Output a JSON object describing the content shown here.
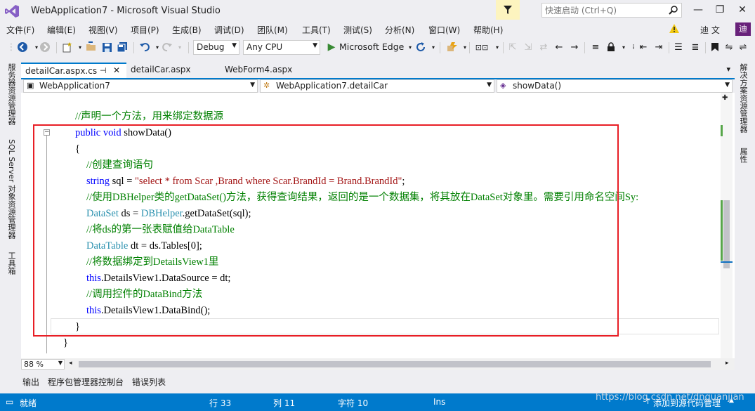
{
  "window": {
    "title": "WebApplication7 - Microsoft Visual Studio",
    "quick_launch_placeholder": "快速启动 (Ctrl+Q)",
    "minimize": "—",
    "restore": "❐",
    "close": "✕"
  },
  "menu": {
    "items": [
      "文件(F)",
      "编辑(E)",
      "视图(V)",
      "项目(P)",
      "生成(B)",
      "调试(D)",
      "团队(M)",
      "工具(T)",
      "测试(S)",
      "分析(N)",
      "窗口(W)",
      "帮助(H)"
    ],
    "user": "迪 文",
    "avatar_letter": "迪"
  },
  "toolbar": {
    "config": "Debug",
    "platform": "Any CPU",
    "run_target": "Microsoft Edge"
  },
  "left_side_tabs": [
    "服务器资源管理器",
    "SQL Server 对象资源管理器",
    "工具箱"
  ],
  "right_side_tabs": [
    "解决方案资源管理器",
    "属性"
  ],
  "doc_tabs": [
    {
      "label": "detailCar.aspx.cs",
      "active": true
    },
    {
      "label": "detailCar.aspx",
      "active": false
    },
    {
      "label": "WebForm4.aspx",
      "active": false
    }
  ],
  "navbar": {
    "project": "WebApplication7",
    "class": "WebApplication7.detailCar",
    "member": "showData()"
  },
  "code": {
    "comment_declare": "//声明一个方法，用来绑定数据源",
    "sig_kw1": "public",
    "sig_kw2": "void",
    "sig_name": "showData()",
    "brace_open": "{",
    "comment_sql": "//创建查询语句",
    "sql_kw": "string",
    "sql_mid": "sql = ",
    "sql_str": "\"select * from Scar ,Brand where Scar.BrandId = Brand.BrandId\"",
    "sql_end": ";",
    "comment_helper": "//使用DBHelper类的getDataSet()方法，获得查询结果，返回的是一个数据集，将其放在DataSet对象里。需要引用命名空间Sy:",
    "ds_type": "DataSet",
    "ds_mid": "ds = ",
    "ds_class": "DBHelper",
    "ds_end": ".getDataSet(sql);",
    "comment_table": "//将ds的第一张表赋值给DataTable",
    "dt_type": "DataTable",
    "dt_rest": "dt = ds.Tables[0];",
    "comment_bind": "//将数据绑定到DetailsView1里",
    "src_this": "this",
    "src_rest": ".DetailsView1.DataSource = dt;",
    "comment_call": "//调用控件的DataBind方法",
    "bind_this": "this",
    "bind_rest": ".DetailsView1.DataBind();",
    "brace_close": "}",
    "brace_outer": "}"
  },
  "zoom": "88 %",
  "bottom_tabs": [
    "输出",
    "程序包管理器控制台",
    "错误列表"
  ],
  "status": {
    "ready": "就绪",
    "line": "行 33",
    "col": "列 11",
    "char": "字符 10",
    "mode": "Ins",
    "source_control": "添加到源代码管理"
  },
  "watermark": "https://blog.csdn.net/dnguanjian",
  "colors": {
    "accent": "#007acc",
    "highlight_box": "#e81e25",
    "vs_purple": "#68217a"
  }
}
